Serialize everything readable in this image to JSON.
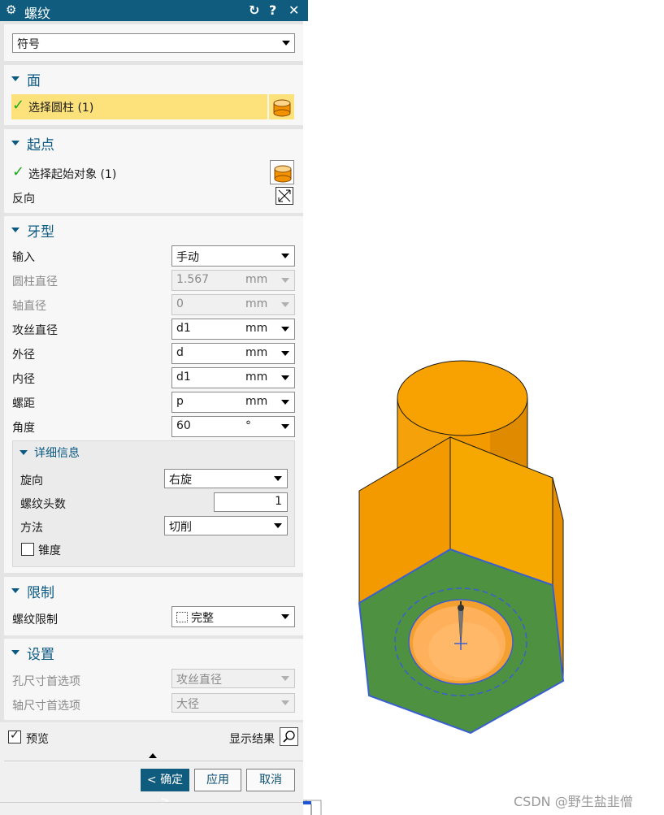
{
  "dialog": {
    "title": "螺纹",
    "type_value": "符号",
    "sections": {
      "face": {
        "header": "面",
        "select_label": "选择圆柱 (1)"
      },
      "start": {
        "header": "起点",
        "select_label": "选择起始对象 (1)",
        "reverse_label": "反向"
      },
      "thread_shape": {
        "header": "牙型",
        "rows": [
          {
            "label": "输入",
            "value": "手动",
            "unit": "",
            "disabled": false
          },
          {
            "label": "圆柱直径",
            "value": "1.567",
            "unit": "mm",
            "disabled": true
          },
          {
            "label": "轴直径",
            "value": "0",
            "unit": "mm",
            "disabled": true
          },
          {
            "label": "攻丝直径",
            "value": "d1",
            "unit": "mm",
            "disabled": false
          },
          {
            "label": "外径",
            "value": "d",
            "unit": "mm",
            "disabled": false
          },
          {
            "label": "内径",
            "value": "d1",
            "unit": "mm",
            "disabled": false
          },
          {
            "label": "螺距",
            "value": "p",
            "unit": "mm",
            "disabled": false
          },
          {
            "label": "角度",
            "value": "60",
            "unit": "°",
            "disabled": false
          }
        ],
        "details": {
          "header": "详细信息",
          "direction_label": "旋向",
          "direction_value": "右旋",
          "starts_label": "螺纹头数",
          "starts_value": "1",
          "method_label": "方法",
          "method_value": "切削",
          "taper_label": "锥度"
        }
      },
      "limit": {
        "header": "限制",
        "limit_label": "螺纹限制",
        "limit_value": "完整"
      },
      "settings": {
        "header": "设置",
        "hole_pref_label": "孔尺寸首选项",
        "hole_pref_value": "攻丝直径",
        "shaft_pref_label": "轴尺寸首选项",
        "shaft_pref_value": "大径"
      }
    },
    "preview_label": "预览",
    "show_result_label": "显示结果",
    "ok_label": "< 确定 >",
    "apply_label": "应用",
    "cancel_label": "取消"
  },
  "watermark": "CSDN @野生盐韭僧",
  "colors": {
    "title_bar": "#0f5c7f",
    "highlight": "#fde17a",
    "part_orange": "#f5a000",
    "face_green": "#4e9140"
  }
}
